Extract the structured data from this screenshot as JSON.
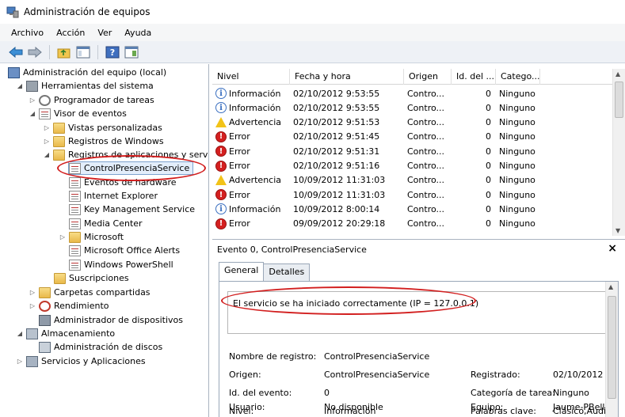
{
  "window": {
    "title": "Administración de equipos"
  },
  "menu": [
    "Archivo",
    "Acción",
    "Ver",
    "Ayuda"
  ],
  "tree": {
    "root": "Administración del equipo (local)",
    "herramientas": "Herramientas del sistema",
    "programador": "Programador de tareas",
    "visor": "Visor de eventos",
    "vistas": "Vistas personalizadas",
    "registros_windows": "Registros de Windows",
    "registros_apps": "Registros de aplicaciones y servici",
    "control": "ControlPresenciaService",
    "hardware": "Eventos de hardware",
    "ie": "Internet Explorer",
    "kms": "Key Management Service",
    "media": "Media Center",
    "microsoft": "Microsoft",
    "office": "Microsoft Office Alerts",
    "powershell": "Windows PowerShell",
    "suscripciones": "Suscripciones",
    "carpetas": "Carpetas compartidas",
    "rendimiento": "Rendimiento",
    "dispositivos": "Administrador de dispositivos",
    "almacenamiento": "Almacenamiento",
    "discos": "Administración de discos",
    "servicios": "Servicios y Aplicaciones"
  },
  "events": {
    "columns": [
      "Nivel",
      "Fecha y hora",
      "Origen",
      "Id. del ...",
      "Catego..."
    ],
    "rows": [
      {
        "level": "Información",
        "type": "info",
        "date": "02/10/2012 9:53:55",
        "origin": "Contro...",
        "id": "0",
        "cat": "Ninguno"
      },
      {
        "level": "Información",
        "type": "info",
        "date": "02/10/2012 9:53:55",
        "origin": "Contro...",
        "id": "0",
        "cat": "Ninguno"
      },
      {
        "level": "Advertencia",
        "type": "warn",
        "date": "02/10/2012 9:51:53",
        "origin": "Contro...",
        "id": "0",
        "cat": "Ninguno"
      },
      {
        "level": "Error",
        "type": "error",
        "date": "02/10/2012 9:51:45",
        "origin": "Contro...",
        "id": "0",
        "cat": "Ninguno"
      },
      {
        "level": "Error",
        "type": "error",
        "date": "02/10/2012 9:51:31",
        "origin": "Contro...",
        "id": "0",
        "cat": "Ninguno"
      },
      {
        "level": "Error",
        "type": "error",
        "date": "02/10/2012 9:51:16",
        "origin": "Contro...",
        "id": "0",
        "cat": "Ninguno"
      },
      {
        "level": "Advertencia",
        "type": "warn",
        "date": "10/09/2012 11:31:03",
        "origin": "Contro...",
        "id": "0",
        "cat": "Ninguno"
      },
      {
        "level": "Error",
        "type": "error",
        "date": "10/09/2012 11:31:03",
        "origin": "Contro...",
        "id": "0",
        "cat": "Ninguno"
      },
      {
        "level": "Información",
        "type": "info",
        "date": "10/09/2012 8:00:14",
        "origin": "Contro...",
        "id": "0",
        "cat": "Ninguno"
      },
      {
        "level": "Error",
        "type": "error",
        "date": "09/09/2012 20:29:18",
        "origin": "Contro...",
        "id": "0",
        "cat": "Ninguno"
      }
    ]
  },
  "detail": {
    "title": "Evento 0, ControlPresenciaService",
    "close": "×",
    "tabs": [
      "General",
      "Detalles"
    ],
    "message": "El servicio se ha iniciado correctamente (IP = 127.0.0.1)",
    "fields": {
      "nombre_label": "Nombre de registro:",
      "nombre_value": "ControlPresenciaService",
      "origen_label": "Origen:",
      "origen_value": "ControlPresenciaService",
      "registrado_label": "Registrado:",
      "registrado_value": "02/10/2012 9",
      "id_label": "Id. del evento:",
      "id_value": "0",
      "categoria_label": "Categoría de tarea:",
      "categoria_value": "Ninguno",
      "nivel_label": "Nivel:",
      "nivel_value": "Información",
      "palabras_label": "Palabras clave:",
      "palabras_value": "Clásico,Audi",
      "usuario_label": "Usuario:",
      "usuario_value": "No disponible",
      "equipo_label": "Equipo:",
      "equipo_value": "Jaume-PBell"
    }
  },
  "colors": {
    "callout": "#d21e1e",
    "selection": "#e3eefb"
  }
}
